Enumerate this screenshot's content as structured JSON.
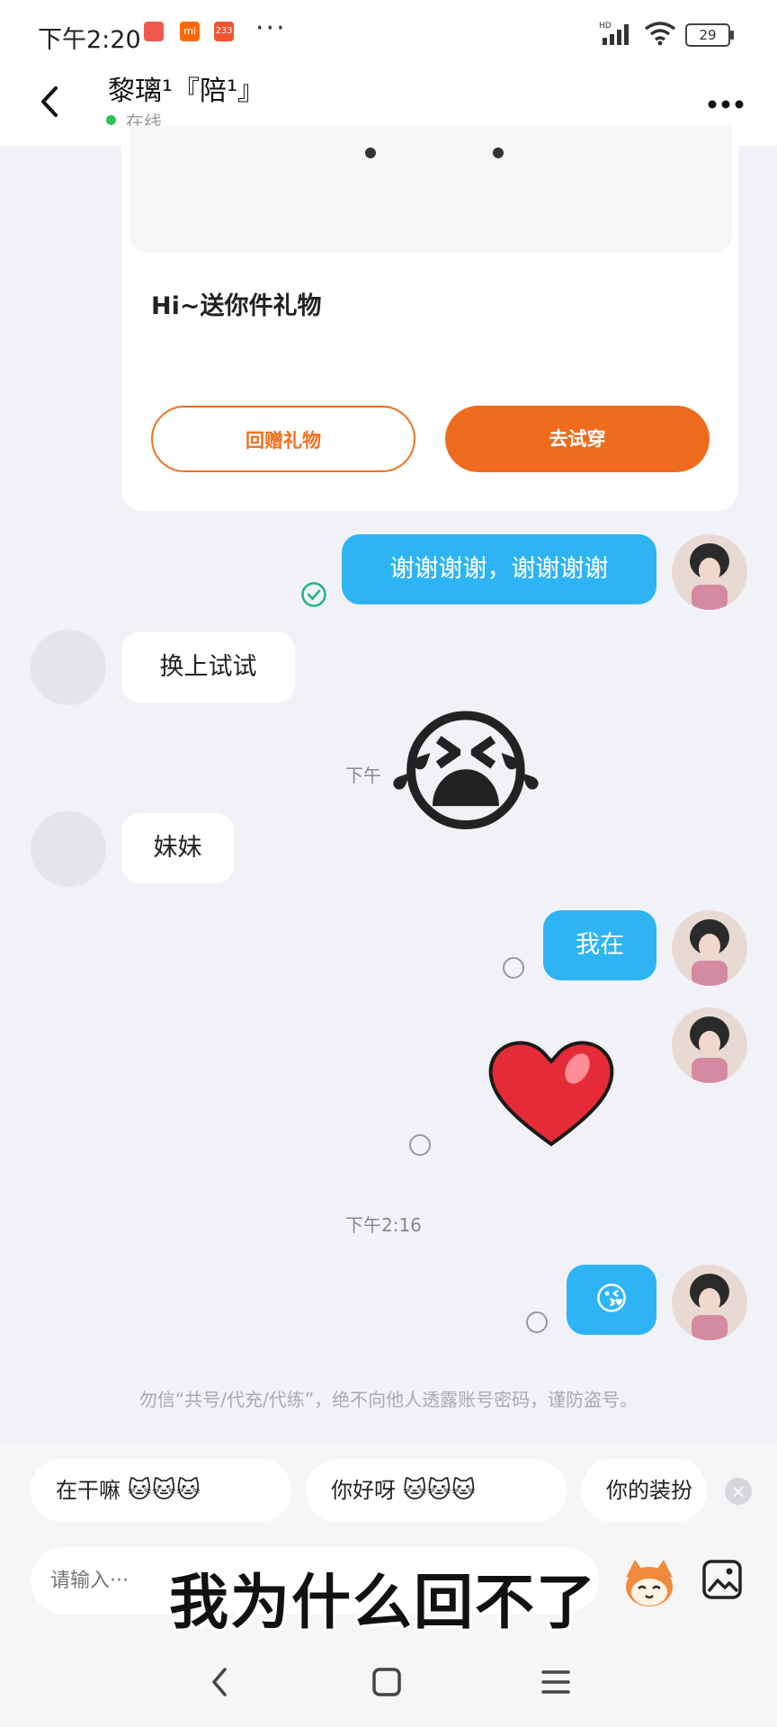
{
  "status_bar": {
    "time": "下午2:20",
    "more": "···",
    "battery": "29",
    "icons": [
      "shop-icon",
      "mi-icon",
      "app-233-icon",
      "signal-icon",
      "wifi-icon",
      "battery-icon"
    ],
    "mi_label": "mi",
    "app_label": "233",
    "hd_label": "HD"
  },
  "header": {
    "name": "黎璃¹『陪¹』",
    "status": "在线"
  },
  "gift_card": {
    "text": "Hi~送你件礼物",
    "return_gift_label": "回赠礼物",
    "try_on_label": "去试穿"
  },
  "messages": [
    {
      "side": "out",
      "text": "谢谢谢谢，谢谢谢谢",
      "status": "read"
    },
    {
      "side": "in",
      "text": "换上试试"
    },
    {
      "type": "time",
      "text": "下午"
    },
    {
      "side": "in",
      "text": "妹妹"
    },
    {
      "side": "out",
      "text": "我在",
      "status": "unread"
    },
    {
      "side": "out",
      "type": "sticker",
      "sticker": "heart-icon",
      "status": "unread"
    },
    {
      "type": "time",
      "text": "下午2:16"
    },
    {
      "side": "out",
      "type": "emoji",
      "text": "😘",
      "status": "unread"
    }
  ],
  "overlay_emoji": "😭",
  "notice": "勿信“共号/代充/代练”，绝不向他人透露账号密码，谨防盗号。",
  "quick_replies": [
    {
      "text": "在干嘛",
      "stickers": "🐱🐱🐱"
    },
    {
      "text": "你好呀",
      "stickers": "🐱🐱🐱"
    },
    {
      "text": "你的装扮",
      "stickers": ""
    }
  ],
  "input": {
    "placeholder": "请输入···"
  },
  "caption": "我为什么回不了",
  "colors": {
    "accent_orange": "#ef6b1e",
    "bubble_blue": "#2fb4f3",
    "online_green": "#2ec455"
  }
}
